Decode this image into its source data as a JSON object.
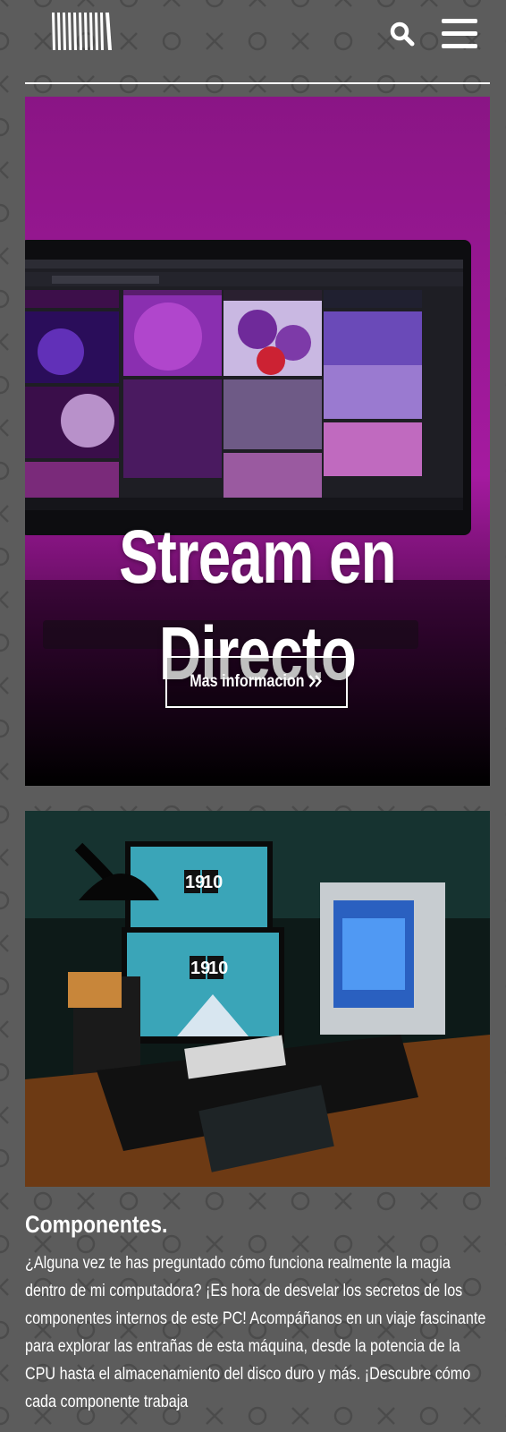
{
  "header": {
    "logo_icon": "barcode-logo-icon",
    "search_icon": "search-icon",
    "menu_icon": "hamburger-menu-icon"
  },
  "hero": {
    "title": "Stream en Directo",
    "button_label": "Mas informacion ",
    "button_icon": "double-chevron-right-icon",
    "accent_color": "#a01a9c"
  },
  "photo": {
    "clock_time": "19 10"
  },
  "section": {
    "title": "Componentes.",
    "text": "¿Alguna vez te has preguntado cómo funciona realmente la magia dentro de mi computadora? ¡Es hora de desvelar los secretos de los componentes internos de este PC! Acompáñanos en un viaje fascinante para explorar las entrañas de esta máquina, desde la potencia de la CPU hasta el almacenamiento del disco duro y más. ¡Descubre cómo cada componente trabaja"
  },
  "colors": {
    "background": "#5c5c5c",
    "pattern": "#4a4a4a",
    "text": "#ffffff"
  }
}
